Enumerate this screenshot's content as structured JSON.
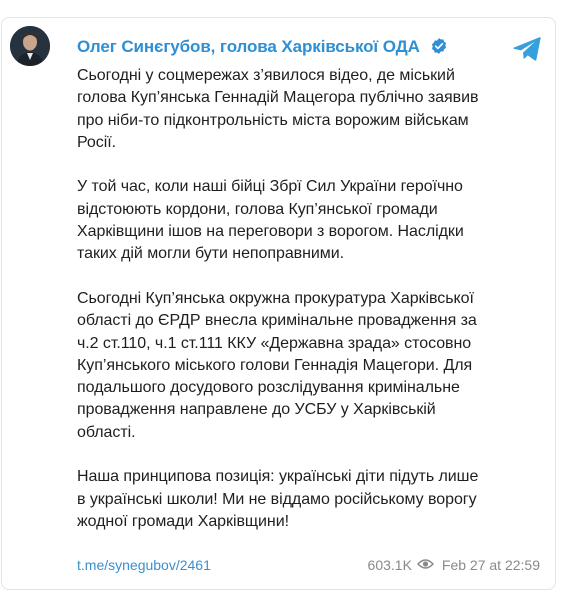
{
  "post": {
    "channel_name": "Олег Синєгубов, голова Харківської ОДА",
    "verified_icon": "verified-check-icon",
    "app_icon": "telegram-icon",
    "paragraphs": [
      "Сьогодні у соцмережах з’явилося відео, де міський\nголова Куп’янська Геннадій Мацегора публічно заявив\nпро ніби-то підконтрольність міста ворожим військам\nРосії.",
      "У той час, коли наші бійці Збрї Сил України героїчно\nвідстоюють кордони, голова Куп’янської громади\nХарківщини ішов на переговори з ворогом. Наслідки\nтаких дій могли бути непоправними.",
      "Сьогодні Куп’янська окружна прокуратура Харківської\nобласті до ЄРДР внесла кримінальне провадження за\nч.2 ст.110, ч.1 ст.111 ККУ «Державна зрада» стосовно\nКуп’янського міського голови Геннадія Мацегори. Для\nподальшого досудового розслідування кримінальне\nпровадження направлене до УСБУ у Харківській\nобласті.",
      "Наша принципова позиція: українські діти підуть лише\nв українські школи! Ми не віддамо російському ворогу\nжодної громади Харківщини!"
    ],
    "link": "t.me/synegubov/2461",
    "views": "603.1K",
    "date": "Feb 27 at 22:59",
    "colors": {
      "accent": "#2e8fd4",
      "text": "#1f1f1f",
      "muted": "#8a8a8a",
      "border": "#e3e3e3"
    }
  }
}
